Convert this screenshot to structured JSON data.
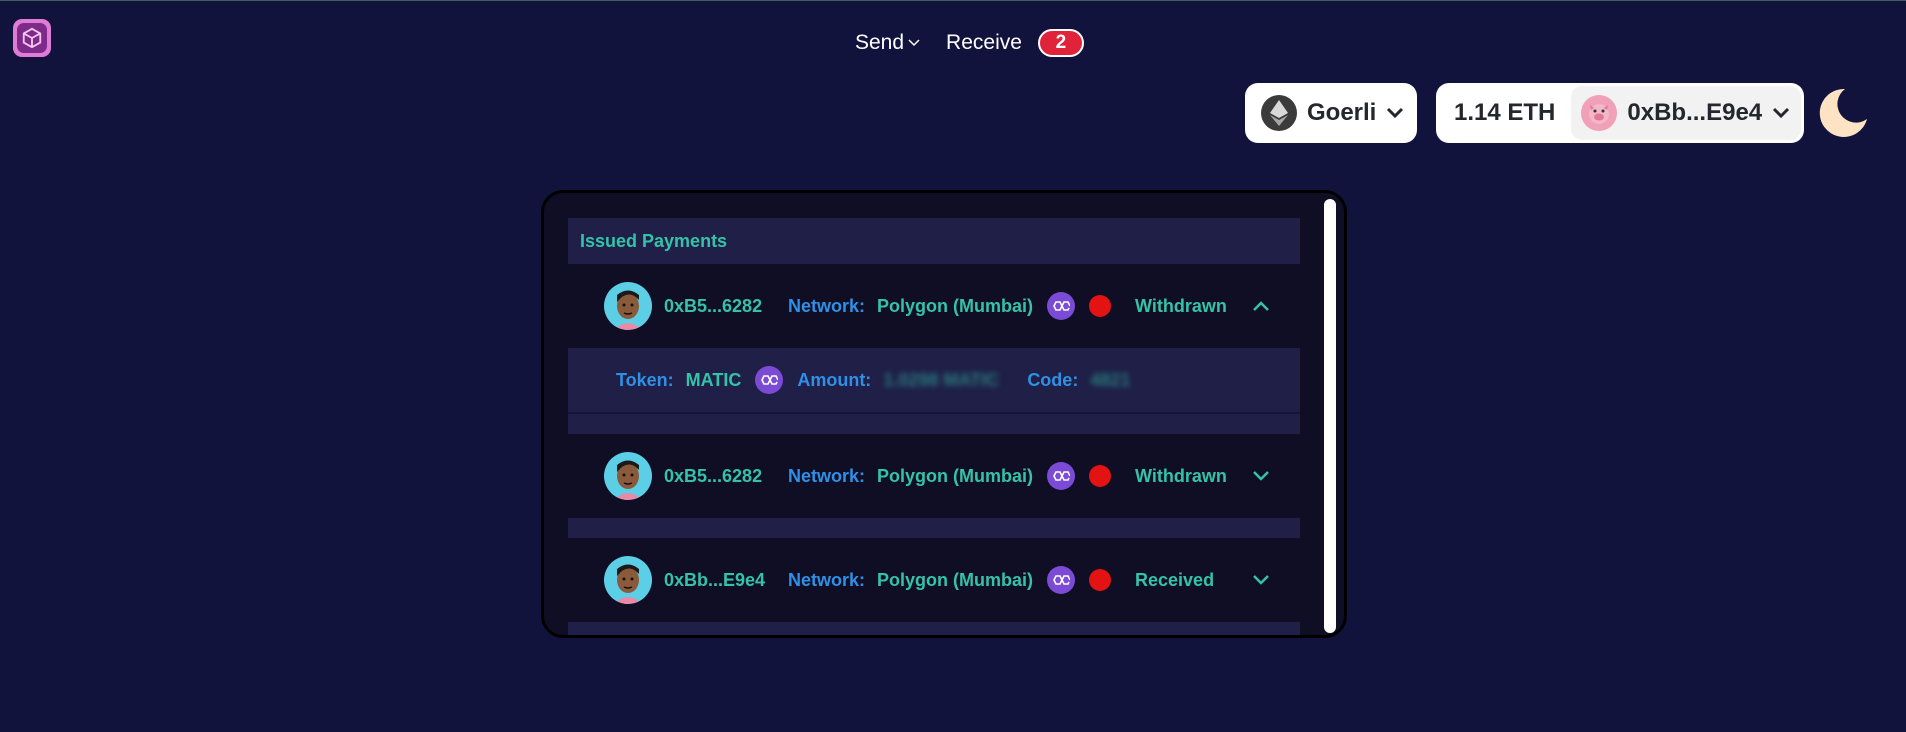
{
  "app": {
    "logo_icon": "cube-logo-icon"
  },
  "nav": {
    "send_label": "Send",
    "receive_label": "Receive",
    "receive_badge": "2"
  },
  "network": {
    "name": "Goerli",
    "icon": "ethereum-icon"
  },
  "account": {
    "balance": "1.14 ETH",
    "address": "0xBb...E9e4",
    "avatar_icon": "pig-avatar-icon"
  },
  "theme": {
    "icon": "moon-icon"
  },
  "panel": {
    "title": "Issued Payments",
    "network_label": "Network:",
    "token_label": "Token:",
    "amount_label": "Amount:",
    "code_label": "Code:",
    "payments": [
      {
        "address": "0xB5...6282",
        "network": "Polygon (Mumbai)",
        "status": "Withdrawn",
        "expanded": true,
        "token": "MATIC",
        "amount": "1.0298 MATIC",
        "code": "4821"
      },
      {
        "address": "0xB5...6282",
        "network": "Polygon (Mumbai)",
        "status": "Withdrawn",
        "expanded": false
      },
      {
        "address": "0xBb...E9e4",
        "network": "Polygon (Mumbai)",
        "status": "Received",
        "expanded": false
      }
    ]
  },
  "colors": {
    "background": "#12133d",
    "accent_green": "#34c3a8",
    "accent_blue": "#2f90e6",
    "badge_red": "#e0233b",
    "status_dot": "#e31313",
    "polygon_purple": "#7b4bd5"
  }
}
